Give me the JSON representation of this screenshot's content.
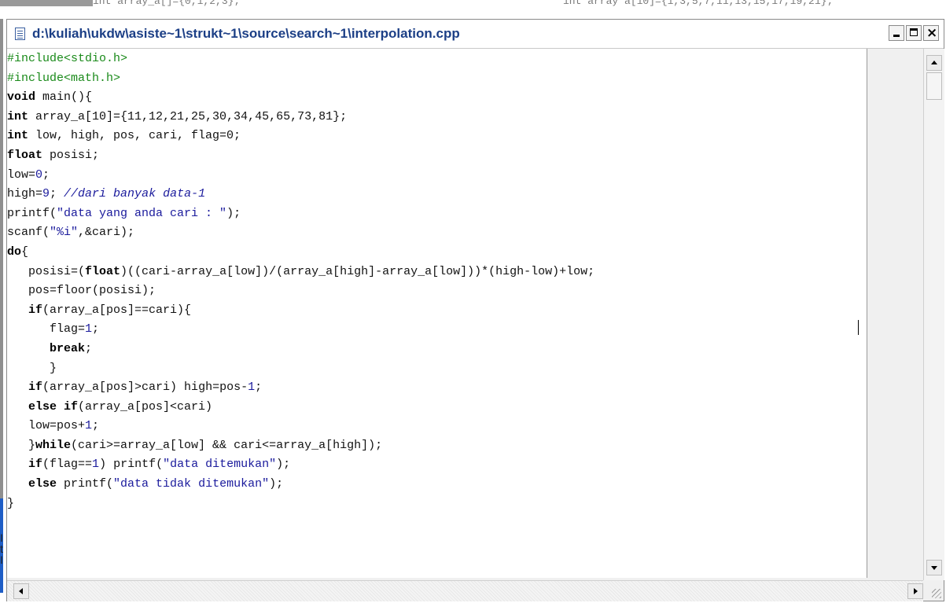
{
  "background": {
    "fragment_left": "int array_a[]={0,1,2,3};",
    "fragment_right": "int array a[10]={1,3,5,7,11,13,15,17,19,21};",
    "side_letters": [
      "I",
      "t",
      "I"
    ]
  },
  "window": {
    "title": "d:\\kuliah\\ukdw\\asiste~1\\strukt~1\\source\\search~1\\interpolation.cpp",
    "minimize_label": "_",
    "maximize_label": "□",
    "close_label": "×"
  },
  "colors": {
    "title_text": "#1c3f86",
    "preprocessor": "#1a8a1a",
    "string_and_number": "#1a1a9c"
  },
  "code_lines": [
    [
      [
        "pp",
        "#include<stdio.h>"
      ]
    ],
    [
      [
        "pp",
        "#include<math.h>"
      ]
    ],
    [
      [
        "kw",
        "void"
      ],
      [
        "t",
        " main(){"
      ]
    ],
    [
      [
        "kw",
        "int"
      ],
      [
        "t",
        " array_a[10]={11,12,21,25,30,34,45,65,73,81};"
      ]
    ],
    [
      [
        "kw",
        "int"
      ],
      [
        "t",
        " low, high, pos, cari, flag=0;"
      ]
    ],
    [
      [
        "kw",
        "float"
      ],
      [
        "t",
        " posisi;"
      ]
    ],
    [
      [
        "t",
        "low="
      ],
      [
        "num",
        "0"
      ],
      [
        "t",
        ";"
      ]
    ],
    [
      [
        "t",
        "high="
      ],
      [
        "num",
        "9"
      ],
      [
        "t",
        "; "
      ],
      [
        "cm",
        "//dari banyak data-1"
      ]
    ],
    [
      [
        "t",
        "printf("
      ],
      [
        "str",
        "\"data yang anda cari : \""
      ],
      [
        "t",
        ");"
      ]
    ],
    [
      [
        "t",
        "scanf("
      ],
      [
        "str",
        "\"%i\""
      ],
      [
        "t",
        ",&cari);"
      ]
    ],
    [
      [
        "kw",
        "do"
      ],
      [
        "t",
        "{"
      ]
    ],
    [
      [
        "t",
        "   posisi=("
      ],
      [
        "kw",
        "float"
      ],
      [
        "t",
        ")((cari-array_a[low])/(array_a[high]-array_a[low]))*(high-low)+low;"
      ]
    ],
    [
      [
        "t",
        "   pos=floor(posisi);"
      ]
    ],
    [
      [
        "t",
        "   "
      ],
      [
        "kw",
        "if"
      ],
      [
        "t",
        "(array_a[pos]==cari){"
      ]
    ],
    [
      [
        "t",
        "      flag="
      ],
      [
        "num",
        "1"
      ],
      [
        "t",
        ";"
      ]
    ],
    [
      [
        "t",
        "      "
      ],
      [
        "kw",
        "break"
      ],
      [
        "t",
        ";"
      ]
    ],
    [
      [
        "t",
        "      }"
      ]
    ],
    [
      [
        "t",
        "   "
      ],
      [
        "kw",
        "if"
      ],
      [
        "t",
        "(array_a[pos]>cari) high=pos-"
      ],
      [
        "num",
        "1"
      ],
      [
        "t",
        ";"
      ]
    ],
    [
      [
        "t",
        "   "
      ],
      [
        "kw",
        "else if"
      ],
      [
        "t",
        "(array_a[pos]<cari)"
      ]
    ],
    [
      [
        "t",
        "   low=pos+"
      ],
      [
        "num",
        "1"
      ],
      [
        "t",
        ";"
      ]
    ],
    [
      [
        "t",
        "   }"
      ],
      [
        "kw",
        "while"
      ],
      [
        "t",
        "(cari>=array_a[low] && cari<=array_a[high]);"
      ]
    ],
    [
      [
        "t",
        "   "
      ],
      [
        "kw",
        "if"
      ],
      [
        "t",
        "(flag=="
      ],
      [
        "num",
        "1"
      ],
      [
        "t",
        ") printf("
      ],
      [
        "str",
        "\"data ditemukan\""
      ],
      [
        "t",
        ");"
      ]
    ],
    [
      [
        "t",
        "   "
      ],
      [
        "kw",
        "else"
      ],
      [
        "t",
        " printf("
      ],
      [
        "str",
        "\"data tidak ditemukan\""
      ],
      [
        "t",
        ");"
      ]
    ],
    [
      [
        "t",
        "}"
      ]
    ]
  ],
  "icons": {
    "file_icon": "document-icon",
    "scroll_up": "arrow-up-icon",
    "scroll_down": "arrow-down-icon",
    "scroll_left": "arrow-left-icon",
    "scroll_right": "arrow-right-icon",
    "resize_grip": "resize-grip-icon"
  }
}
